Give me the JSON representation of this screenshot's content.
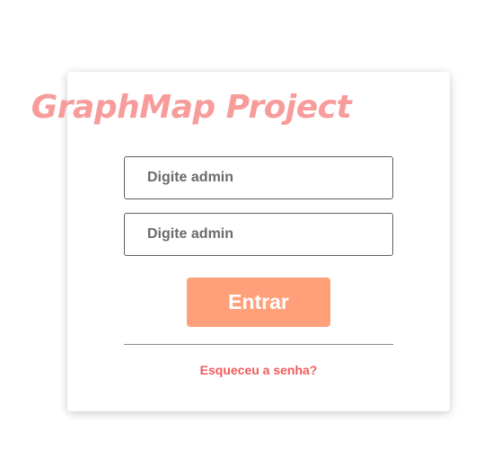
{
  "login": {
    "title": "GraphMap Project",
    "username_placeholder": "Digite admin",
    "password_placeholder": "Digite admin",
    "submit_label": "Entrar",
    "forgot_password_label": "Esqueceu a senha?"
  },
  "colors": {
    "title": "#f79b9b",
    "button": "#ffa07a",
    "link": "#ef5b5b"
  }
}
